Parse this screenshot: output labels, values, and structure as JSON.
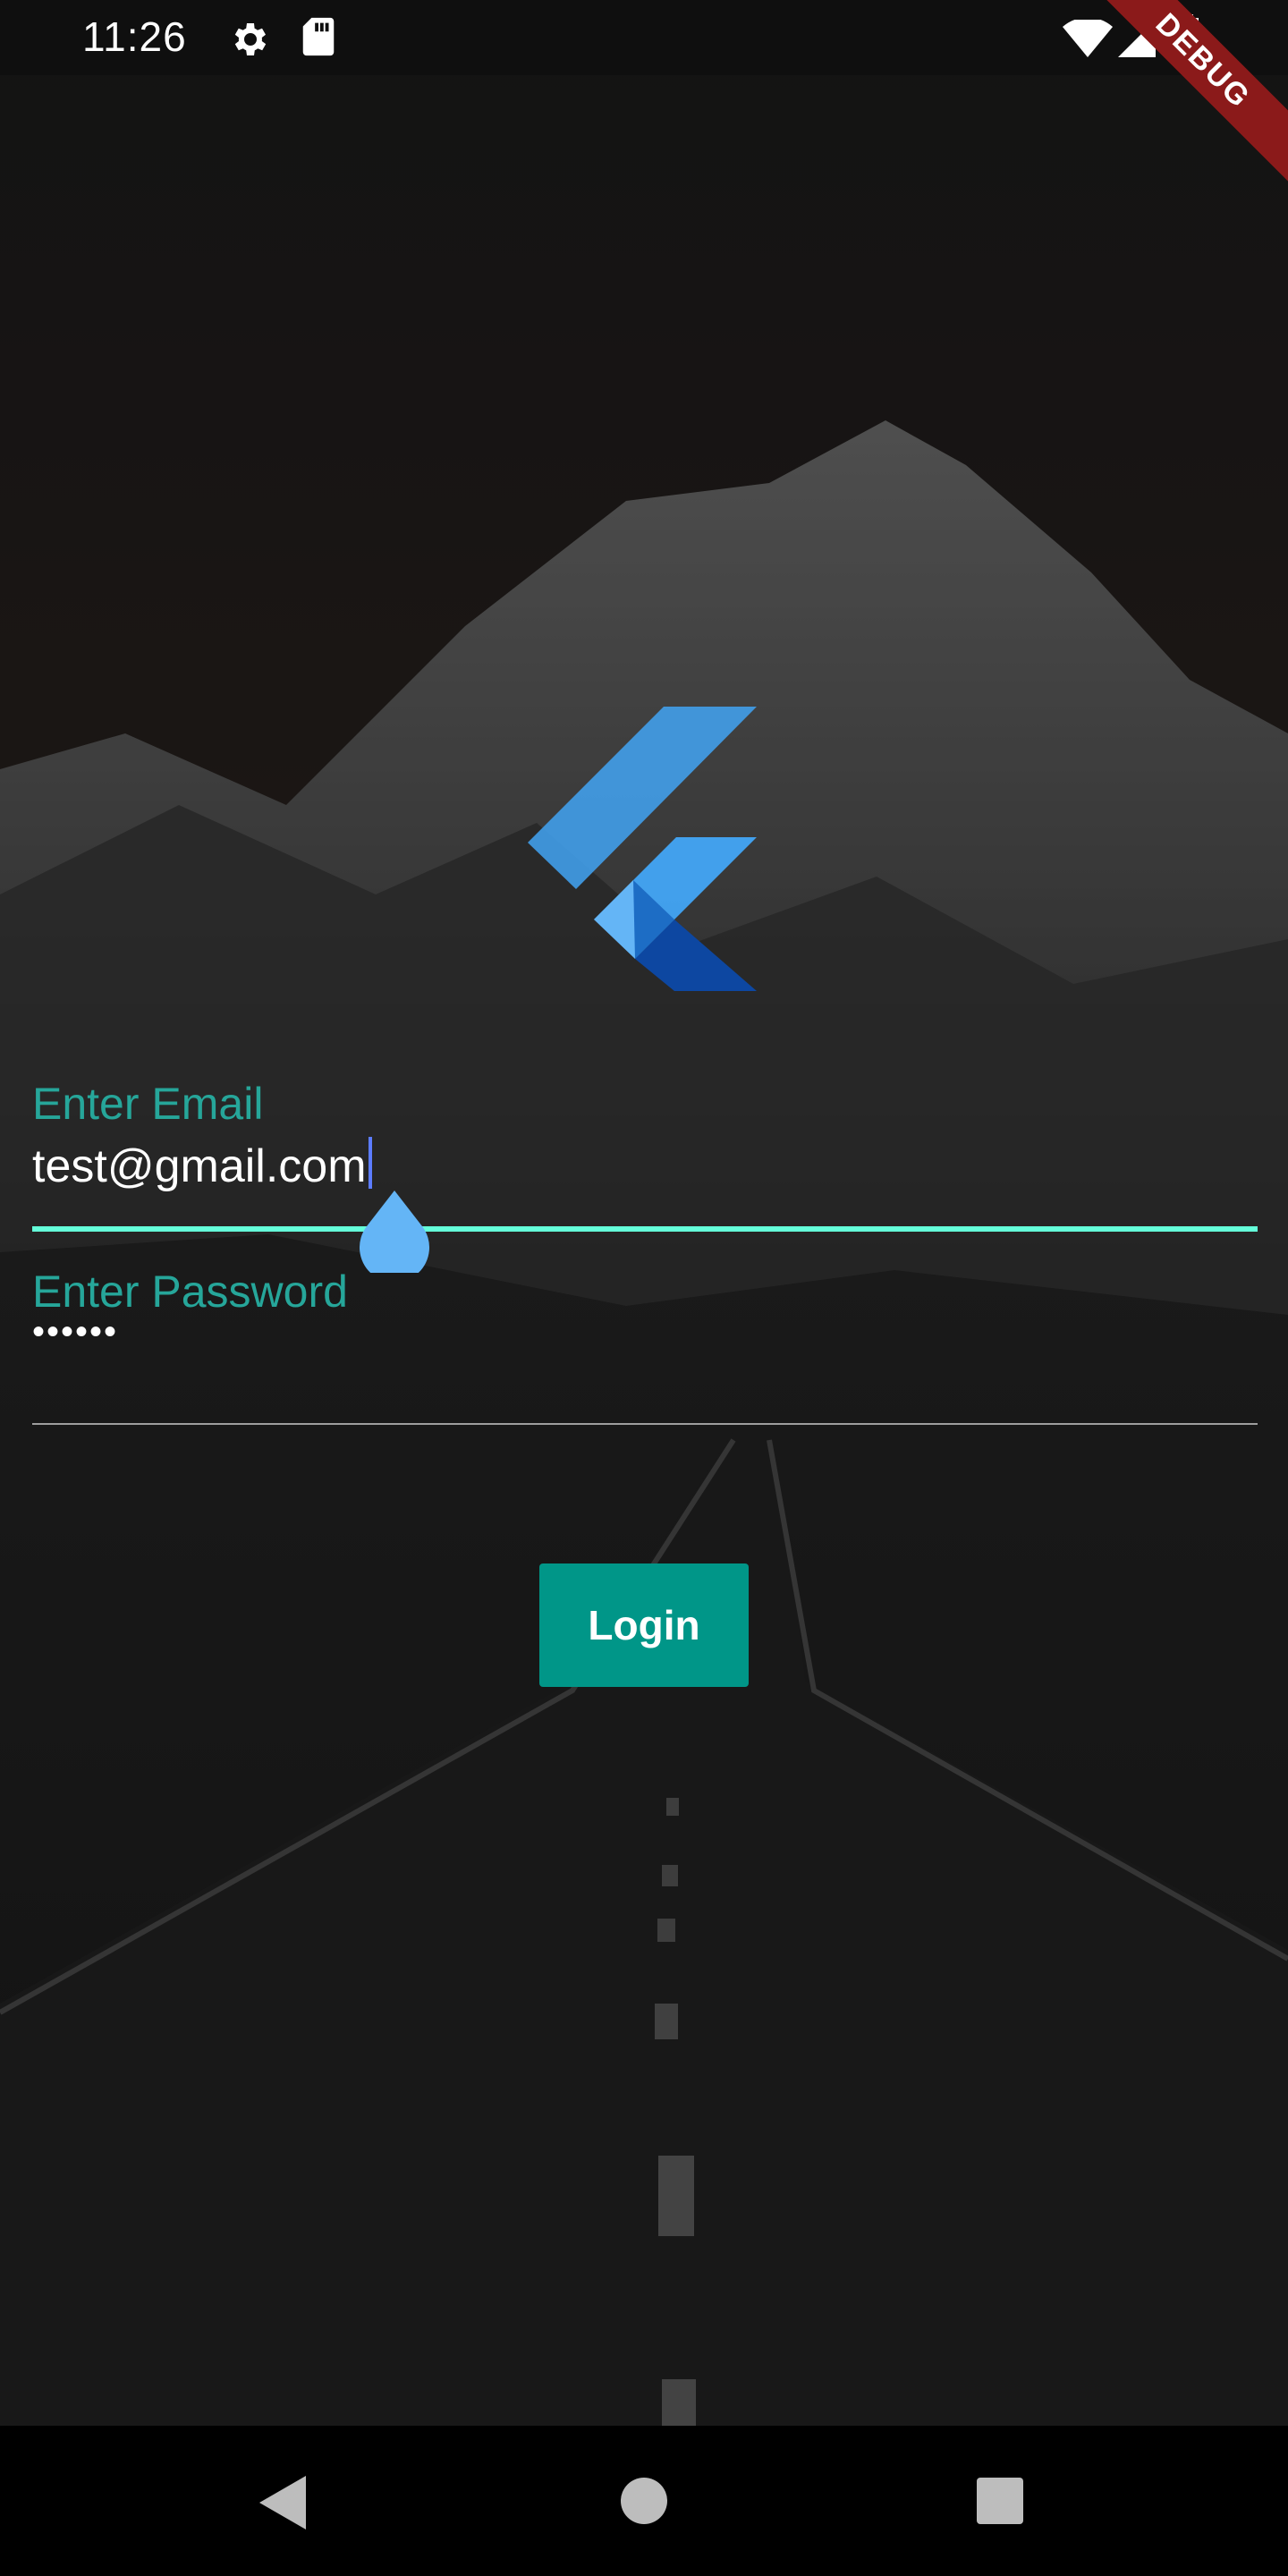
{
  "status_bar": {
    "time": "11:26",
    "icons": [
      "settings-icon",
      "sd-card-icon",
      "wifi-icon",
      "signal-icon",
      "battery-icon"
    ]
  },
  "debug_banner": "DEBUG",
  "logo": "flutter-logo",
  "email": {
    "label": "Enter Email",
    "value": "test@gmail.com"
  },
  "password": {
    "label": "Enter Password",
    "value": "••••••"
  },
  "login_button": "Login",
  "nav_bar": {
    "icons": [
      "back-icon",
      "home-icon",
      "recents-icon"
    ]
  },
  "colors": {
    "accent": "#26a69a",
    "active_underline": "#64ffda",
    "button": "#009688",
    "handle": "#64b5f6"
  }
}
